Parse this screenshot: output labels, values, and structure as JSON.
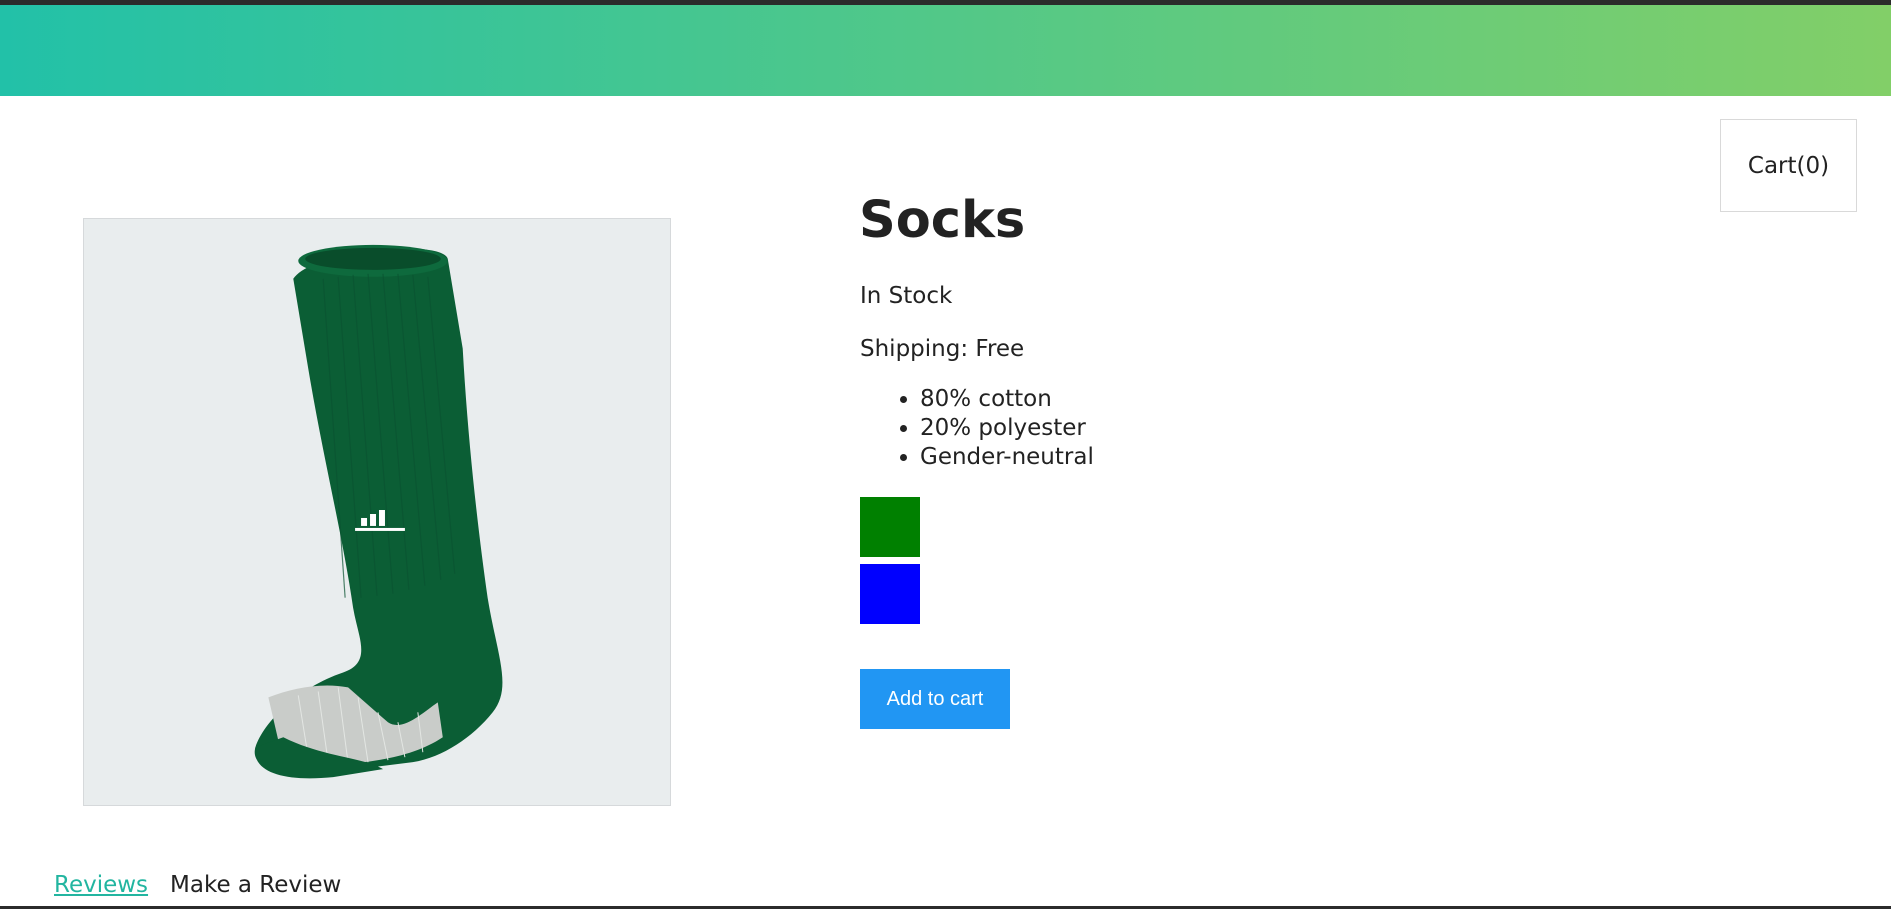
{
  "header": {
    "gradient_start": "#22c1a8",
    "gradient_end": "#82cf68"
  },
  "cart": {
    "label": "Cart(0)"
  },
  "product": {
    "title": "Socks",
    "stock": "In Stock",
    "shipping": "Shipping: Free",
    "features": [
      "80% cotton",
      "20% polyester",
      "Gender-neutral"
    ],
    "image_icon": "green-sock-image",
    "swatches": [
      {
        "name": "green",
        "color": "#008000"
      },
      {
        "name": "blue",
        "color": "#0000ff"
      }
    ],
    "add_to_cart_label": "Add to cart",
    "add_to_cart_color": "#2196f3"
  },
  "tabs": {
    "reviews": "Reviews",
    "make_review": "Make a Review",
    "active_color": "#22b5a0"
  }
}
